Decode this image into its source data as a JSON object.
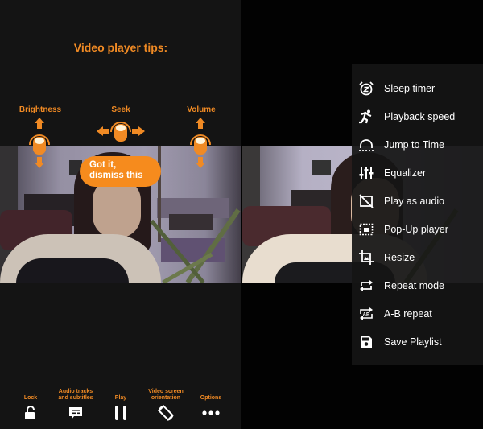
{
  "tips": {
    "title": "Video player tips:",
    "gestures": [
      {
        "label": "Brightness",
        "direction": "vertical"
      },
      {
        "label": "Seek",
        "direction": "horizontal"
      },
      {
        "label": "Volume",
        "direction": "vertical"
      }
    ],
    "dismiss_button": "Got it,\ndismiss this",
    "dismiss_line1": "Got it,",
    "dismiss_line2": "dismiss this"
  },
  "controls": [
    {
      "label": "Lock",
      "icon": "unlock-icon"
    },
    {
      "label": "Audio tracks and subtitles",
      "line1": "Audio tracks",
      "line2": "and subtitles",
      "icon": "subtitles-icon"
    },
    {
      "label": "Play",
      "icon": "pause-icon"
    },
    {
      "label": "Video screen orientation",
      "line1": "Video screen",
      "line2": "orientation",
      "icon": "rotate-screen-icon"
    },
    {
      "label": "Options",
      "icon": "more-icon"
    }
  ],
  "options_menu": {
    "items": [
      {
        "label": "Sleep timer",
        "icon": "alarm-clock-icon"
      },
      {
        "label": "Playback speed",
        "icon": "running-icon"
      },
      {
        "label": "Jump to Time",
        "icon": "jump-time-icon"
      },
      {
        "label": "Equalizer",
        "icon": "equalizer-icon"
      },
      {
        "label": "Play as audio",
        "icon": "video-off-icon"
      },
      {
        "label": "Pop-Up player",
        "icon": "popup-player-icon"
      },
      {
        "label": "Resize",
        "icon": "crop-icon"
      },
      {
        "label": "Repeat mode",
        "icon": "repeat-icon"
      },
      {
        "label": "A-B repeat",
        "icon": "ab-repeat-icon"
      },
      {
        "label": "Save Playlist",
        "icon": "save-icon"
      }
    ]
  },
  "colors": {
    "accent": "#f08a24",
    "button": "#f68b1d",
    "panel_bg": "#141414",
    "menu_text": "#ffffff"
  }
}
